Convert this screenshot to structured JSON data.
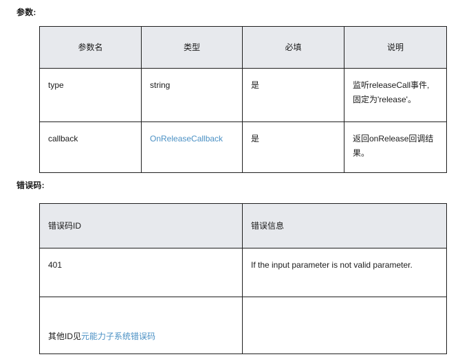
{
  "sections": {
    "params_label": "参数:",
    "errcodes_label": "错误码:"
  },
  "params_table": {
    "headers": [
      "参数名",
      "类型",
      "必填",
      "说明"
    ],
    "rows": [
      {
        "name": "type",
        "type": "string",
        "type_is_link": false,
        "required": "是",
        "description": "监听releaseCall事件, 固定为'release'。"
      },
      {
        "name": "callback",
        "type": "OnReleaseCallback",
        "type_is_link": true,
        "required": "是",
        "description": "返回onRelease回调结果。"
      }
    ]
  },
  "errcodes_table": {
    "headers": [
      "错误码ID",
      "错误信息"
    ],
    "rows": [
      {
        "id": "401",
        "id_prefix": "401",
        "id_link": "",
        "message": "If the input parameter is not valid parameter."
      },
      {
        "id": "其他ID见元能力子系统错误码",
        "id_prefix": "其他ID见",
        "id_link": "元能力子系统错误码",
        "message": ""
      }
    ]
  },
  "colors": {
    "link": "#4a90c4",
    "header_bg": "#e7e9ed",
    "border": "#1d1d1d",
    "text": "#1a1a1a"
  }
}
